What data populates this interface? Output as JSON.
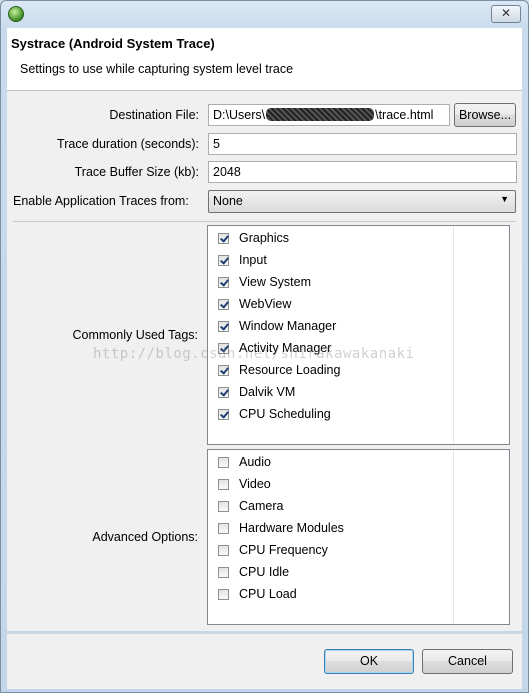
{
  "window": {
    "app_icon": "android-eclipse-icon",
    "close_icon": "close-x-icon",
    "close_glyph": "✕"
  },
  "header": {
    "title": "Systrace (Android System Trace)",
    "subtitle": "Settings to use while capturing system level trace"
  },
  "form": {
    "destination": {
      "label": "Destination File:",
      "value_prefix": "D:\\Users\\",
      "value_suffix": "\\trace.html",
      "browse_label": "Browse..."
    },
    "duration": {
      "label": "Trace duration (seconds):",
      "value": "5"
    },
    "buffer": {
      "label": "Trace Buffer Size (kb):",
      "value": "2048"
    },
    "app_traces": {
      "label": "Enable Application Traces from:",
      "selected": "None",
      "arrow_icon": "dropdown-arrow-icon",
      "arrow_glyph": "▼"
    }
  },
  "common_tags": {
    "label": "Commonly Used Tags:",
    "items": [
      {
        "label": "Graphics",
        "checked": true
      },
      {
        "label": "Input",
        "checked": true
      },
      {
        "label": "View System",
        "checked": true
      },
      {
        "label": "WebView",
        "checked": true
      },
      {
        "label": "Window Manager",
        "checked": true
      },
      {
        "label": "Activity Manager",
        "checked": true
      },
      {
        "label": "Resource Loading",
        "checked": true
      },
      {
        "label": "Dalvik VM",
        "checked": true
      },
      {
        "label": "CPU Scheduling",
        "checked": true
      }
    ]
  },
  "advanced": {
    "label": "Advanced Options:",
    "items": [
      {
        "label": "Audio",
        "checked": false
      },
      {
        "label": "Video",
        "checked": false
      },
      {
        "label": "Camera",
        "checked": false
      },
      {
        "label": "Hardware Modules",
        "checked": false
      },
      {
        "label": "CPU Frequency",
        "checked": false
      },
      {
        "label": "CPU Idle",
        "checked": false
      },
      {
        "label": "CPU Load",
        "checked": false
      }
    ]
  },
  "watermark": "http://blog.csdn.net/shirakawakanaki",
  "buttons": {
    "ok": "OK",
    "cancel": "Cancel"
  }
}
